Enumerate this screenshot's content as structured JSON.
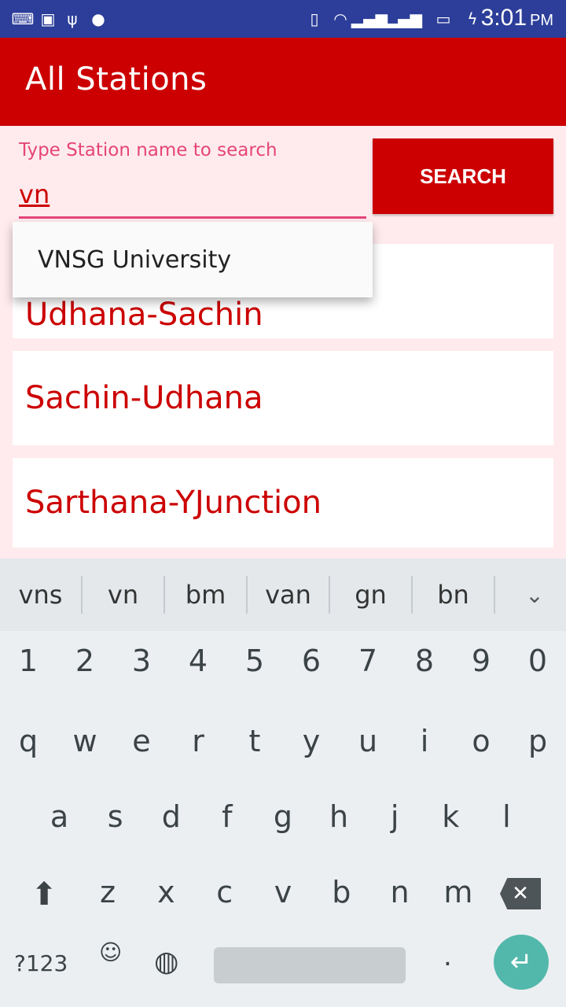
{
  "status_bar": {
    "time": "3:01",
    "ampm": "PM"
  },
  "toolbar": {
    "title": "All Stations"
  },
  "search": {
    "label": "Type Station name to search",
    "value": "vn",
    "button_label": "SEARCH"
  },
  "dropdown": {
    "suggestion": "VNSG University"
  },
  "stations": [
    {
      "name": "Udhana-Sachin"
    },
    {
      "name": "Sachin-Udhana"
    },
    {
      "name": "Sarthana-YJunction"
    }
  ],
  "keyboard": {
    "suggestions": [
      "vns",
      "vn",
      "bm",
      "van",
      "gn",
      "bn"
    ],
    "row_numbers": [
      "1",
      "2",
      "3",
      "4",
      "5",
      "6",
      "7",
      "8",
      "9",
      "0"
    ],
    "row_top": [
      "q",
      "w",
      "e",
      "r",
      "t",
      "y",
      "u",
      "i",
      "o",
      "p"
    ],
    "row_mid": [
      "a",
      "s",
      "d",
      "f",
      "g",
      "h",
      "j",
      "k",
      "l"
    ],
    "row_bottom": [
      "z",
      "x",
      "c",
      "v",
      "b",
      "n",
      "m"
    ],
    "symbols_label": "?123",
    "period_label": "."
  },
  "colors": {
    "status_bar": "#2c3e99",
    "primary": "#cc0000",
    "accent": "#e6457a",
    "background": "#ffebee",
    "enter": "#52b8ab"
  }
}
